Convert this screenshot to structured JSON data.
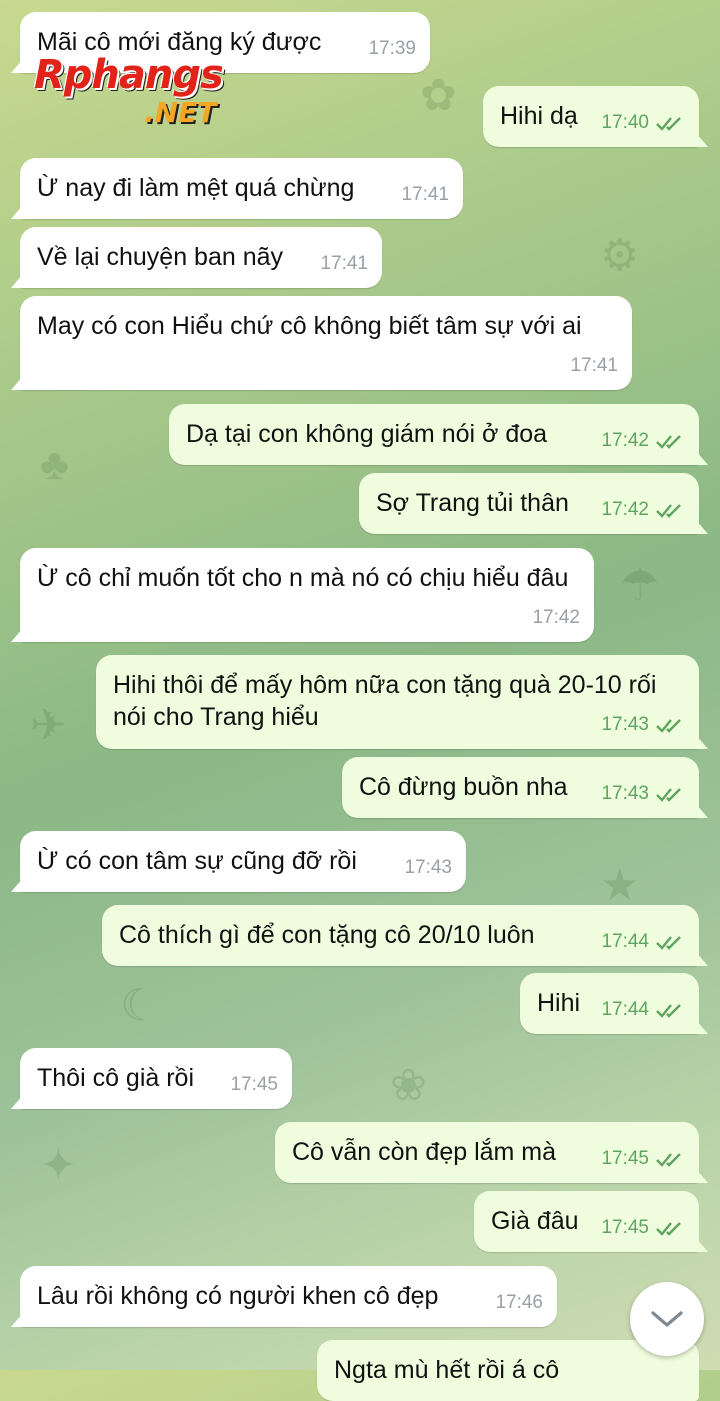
{
  "watermark": {
    "brand": "Rphangs",
    "net": ".NET"
  },
  "messages": [
    {
      "dir": "in",
      "text": "Mãi cô mới đăng ký được",
      "time": "17:39"
    },
    {
      "dir": "out",
      "text": "Hihi dạ",
      "time": "17:40",
      "read": true
    },
    {
      "dir": "in",
      "text": "Ừ nay đi làm mệt quá chừng",
      "time": "17:41"
    },
    {
      "dir": "in",
      "text": "Về lại chuyện ban nãy",
      "time": "17:41"
    },
    {
      "dir": "in",
      "text": "May có con Hiểu chứ cô không biết tâm sự với ai",
      "time": "17:41"
    },
    {
      "dir": "out",
      "text": "Dạ tại con không giám nói ở đoa",
      "time": "17:42",
      "read": true
    },
    {
      "dir": "out",
      "text": "Sợ Trang tủi thân",
      "time": "17:42",
      "read": true
    },
    {
      "dir": "in",
      "text": "Ừ cô chỉ muốn tốt cho n mà nó có chịu hiểu đâu",
      "time": "17:42"
    },
    {
      "dir": "out",
      "text": "Hihi thôi để mấy hôm nữa con tặng quà 20-10 rối nói cho Trang hiểu",
      "time": "17:43",
      "read": true
    },
    {
      "dir": "out",
      "text": "Cô đừng buồn nha",
      "time": "17:43",
      "read": true
    },
    {
      "dir": "in",
      "text": "Ừ có con tâm sự cũng đỡ rồi",
      "time": "17:43"
    },
    {
      "dir": "out",
      "text": "Cô thích gì để con tặng cô 20/10 luôn",
      "time": "17:44",
      "read": true
    },
    {
      "dir": "out",
      "text": "Hihi",
      "time": "17:44",
      "read": true
    },
    {
      "dir": "in",
      "text": "Thôi cô già rồi",
      "time": "17:45"
    },
    {
      "dir": "out",
      "text": "Cô vẫn còn đẹp lắm mà",
      "time": "17:45",
      "read": true
    },
    {
      "dir": "out",
      "text": "Già đâu",
      "time": "17:45",
      "read": true
    },
    {
      "dir": "in",
      "text": "Lâu rồi không có người khen cô đẹp",
      "time": "17:46"
    },
    {
      "dir": "out",
      "text": "Ngta mù hết rồi á cô",
      "time": ""
    }
  ],
  "scroll_button": {
    "icon": "chevron-down-icon"
  },
  "colors": {
    "incoming": "#ffffff",
    "outgoing": "#effdde",
    "tick": "#5fa45f"
  }
}
